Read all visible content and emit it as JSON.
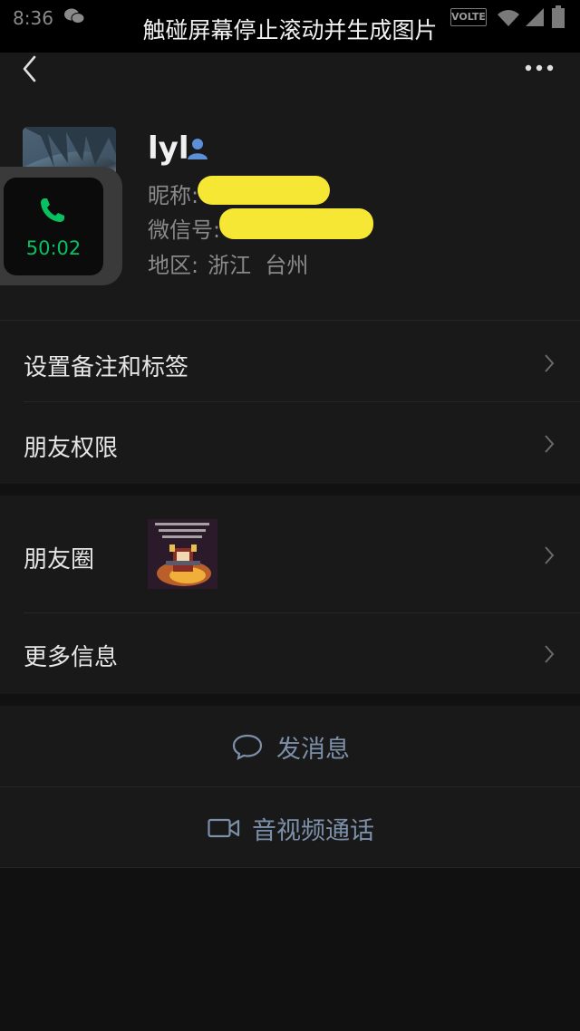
{
  "status_bar": {
    "time": "8:36",
    "banner": "触碰屏幕停止滚动并生成图片",
    "network_badge": "VOLTE"
  },
  "nav": {
    "back_icon": "chevron-left-icon",
    "more_icon": "more-dots-icon"
  },
  "profile": {
    "name": "lyl",
    "nickname_label": "昵称:",
    "wechat_id_label": "微信号:",
    "region_label": "地区:",
    "region_value": "浙江  台州"
  },
  "floating_call": {
    "duration": "50:02",
    "icon": "phone-icon",
    "accent_color": "#07c160"
  },
  "menu": {
    "remark_tags": "设置备注和标签",
    "friend_permissions": "朋友权限",
    "moments": "朋友圈",
    "more_info": "更多信息"
  },
  "actions": {
    "message": "发消息",
    "av_call": "音视频通话"
  },
  "colors": {
    "background": "#111111",
    "panel": "#191919",
    "link_blue": "#7d90a9",
    "redaction": "#f5e733"
  }
}
